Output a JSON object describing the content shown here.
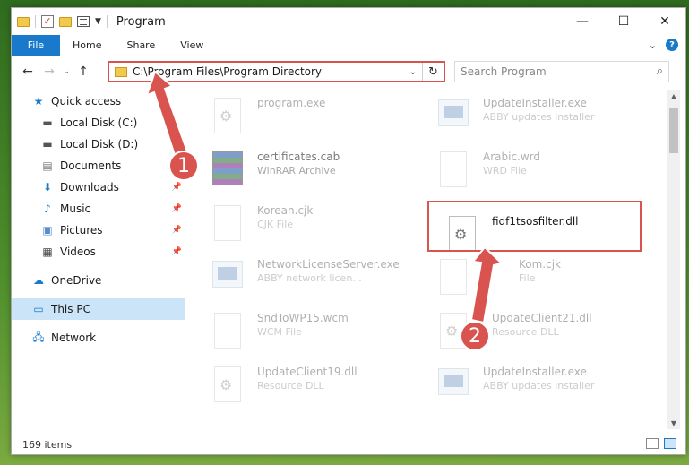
{
  "window": {
    "title": "Program"
  },
  "ribbon": {
    "file": "File",
    "tabs": [
      "Home",
      "Share",
      "View"
    ]
  },
  "address": {
    "path": "C:\\Program Files\\Program Directory"
  },
  "search": {
    "placeholder": "Search Program"
  },
  "sidebar": {
    "quick_access": "Quick access",
    "items": [
      {
        "label": "Local Disk (C:)",
        "icon": "drive-icon",
        "pinned": false
      },
      {
        "label": "Local Disk (D:)",
        "icon": "drive-icon",
        "pinned": false
      },
      {
        "label": "Documents",
        "icon": "documents-icon",
        "pinned": false
      },
      {
        "label": "Downloads",
        "icon": "download-icon",
        "pinned": true
      },
      {
        "label": "Music",
        "icon": "music-icon",
        "pinned": true
      },
      {
        "label": "Pictures",
        "icon": "pictures-icon",
        "pinned": true
      },
      {
        "label": "Videos",
        "icon": "videos-icon",
        "pinned": true
      }
    ],
    "onedrive": "OneDrive",
    "this_pc": "This PC",
    "network": "Network"
  },
  "files": [
    {
      "name": "program.exe",
      "type": "",
      "faded": true
    },
    {
      "name": "UpdateInstaller.exe",
      "type": "ABBY updates installer",
      "faded": true
    },
    {
      "name": "certificates.cab",
      "type": "WinRAR Archive",
      "faded": true
    },
    {
      "name": "Arabic.wrd",
      "type": "WRD File",
      "faded": true
    },
    {
      "name": "Korean.cjk",
      "type": "CJK File",
      "faded": true
    },
    {
      "name": "fidf1tsosfilter.dll",
      "type": "",
      "faded": false
    },
    {
      "name": "NetworkLicenseServer.exe",
      "type": "ABBY network licen...",
      "faded": true
    },
    {
      "name": "Kom.cjk",
      "type": "File",
      "faded": true
    },
    {
      "name": "SndToWP15.wcm",
      "type": "WCM File",
      "faded": true
    },
    {
      "name": "UpdateClient21.dll",
      "type": "Resource DLL",
      "faded": true
    },
    {
      "name": "UpdateClient19.dll",
      "type": "Resource DLL",
      "faded": true
    },
    {
      "name": "UpdateInstaller.exe",
      "type": "ABBY updates installer",
      "faded": true
    }
  ],
  "status": {
    "count": "169 items"
  },
  "markers": [
    "1",
    "2"
  ],
  "colors": {
    "accent": "#1979ca",
    "annotation": "#d9534f",
    "selected": "#cce4f7"
  }
}
